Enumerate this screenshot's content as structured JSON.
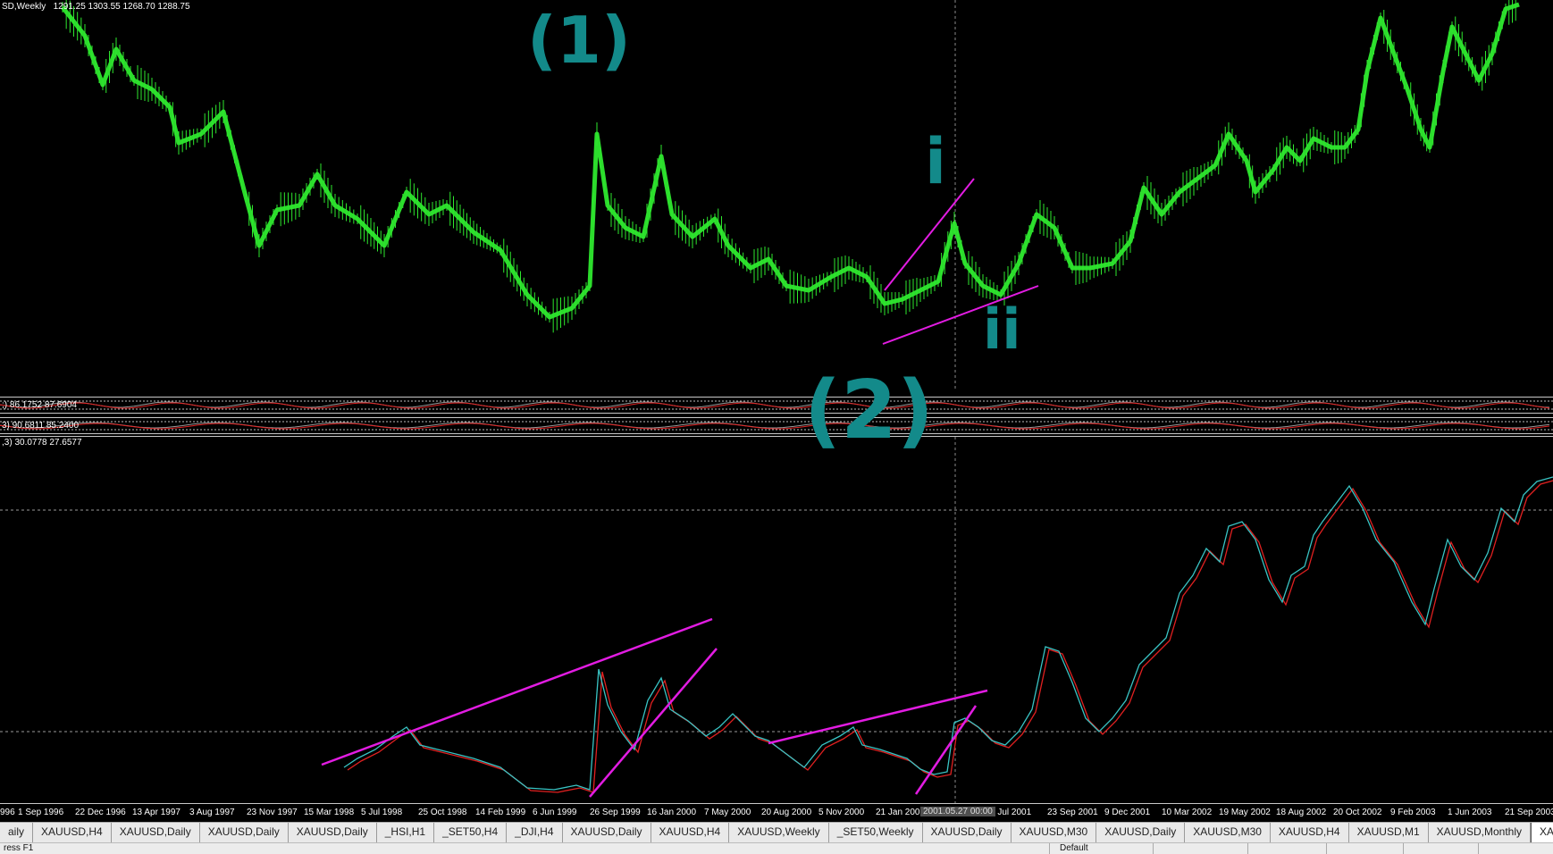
{
  "window": {
    "symbol_caption": "SD,Weekly",
    "ohlc": "1291.25 1303.55 1268.70 1288.75"
  },
  "indicators": {
    "osc1_label": ";) 86.1752 87.6904",
    "osc2_label": "3) 90.6811 85.2400",
    "stoch_label": ",3) 30.0778 27.6577"
  },
  "annotations": {
    "label_1": "(1)",
    "label_2": "(2)",
    "label_i": "i",
    "label_ii": "ii"
  },
  "axis": {
    "dates": [
      "996",
      "1 Sep 1996",
      "22 Dec 1996",
      "13 Apr 1997",
      "3 Aug 1997",
      "23 Nov 1997",
      "15 Mar 1998",
      "5 Jul 1998",
      "25 Oct 1998",
      "14 Feb 1999",
      "6 Jun 1999",
      "26 Sep 1999",
      "16 Jan 2000",
      "7 May 2000",
      "20 Aug 2000",
      "5 Nov 2000",
      "21 Jan 2001",
      "8 Jul 2001",
      "23 Sep 2001",
      "9 Dec 2001",
      "10 Mar 2002",
      "19 May 2002",
      "18 Aug 2002",
      "20 Oct 2002",
      "9 Feb 2003",
      "1 Jun 2003",
      "21 Sep 2003"
    ],
    "crosshair_date": "2001.05.27 00:00"
  },
  "tabs": [
    {
      "label": "aily",
      "active": false
    },
    {
      "label": "XAUUSD,H4",
      "active": false
    },
    {
      "label": "XAUUSD,Daily",
      "active": false
    },
    {
      "label": "XAUUSD,Daily",
      "active": false
    },
    {
      "label": "XAUUSD,Daily",
      "active": false
    },
    {
      "label": "_HSI,H1",
      "active": false
    },
    {
      "label": "_SET50,H4",
      "active": false
    },
    {
      "label": "_DJI,H4",
      "active": false
    },
    {
      "label": "XAUUSD,Daily",
      "active": false
    },
    {
      "label": "XAUUSD,H4",
      "active": false
    },
    {
      "label": "XAUUSD,Weekly",
      "active": false
    },
    {
      "label": "_SET50,Weekly",
      "active": false
    },
    {
      "label": "XAUUSD,Daily",
      "active": false
    },
    {
      "label": "XAUUSD,M30",
      "active": false
    },
    {
      "label": "XAUUSD,Daily",
      "active": false
    },
    {
      "label": "XAUUSD,M30",
      "active": false
    },
    {
      "label": "XAUUSD,H4",
      "active": false
    },
    {
      "label": "XAUUSD,M1",
      "active": false
    },
    {
      "label": "XAUUSD,Monthly",
      "active": false
    },
    {
      "label": "XAUUSD,Weekly",
      "active": true
    }
  ],
  "status": {
    "left_text": "ress F1",
    "profile": "Default"
  },
  "colors": {
    "background": "#000000",
    "candles": "#2ee82e",
    "trendlines": "#e21ce2",
    "annotation": "#138a8a",
    "stoch_main": "#39c4c4",
    "stoch_signal": "#e02020"
  }
}
